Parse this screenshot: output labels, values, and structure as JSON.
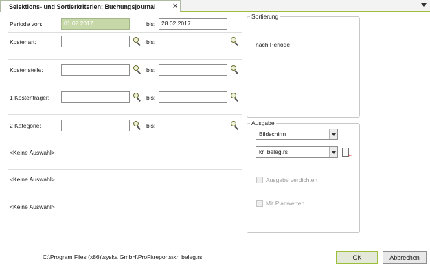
{
  "tab": {
    "title": "Selektions- und Sortierkriterien: Buchungsjournal",
    "close": "✕"
  },
  "rows": [
    {
      "label": "Periode von:",
      "from": "01.02.2017",
      "bis": "bis:",
      "to": "28.02.2017"
    },
    {
      "label": "Kostenart:",
      "from": "",
      "bis": "bis:",
      "to": ""
    },
    {
      "label": "Kostenstelle:",
      "from": "",
      "bis": "bis:",
      "to": ""
    },
    {
      "label": "1 Kostenträger:",
      "from": "",
      "bis": "bis:",
      "to": ""
    },
    {
      "label": "2 Kategorie:",
      "from": "",
      "bis": "bis:",
      "to": ""
    }
  ],
  "no_selection": [
    "<Keine Auswahl>",
    "<Keine Auswahl>",
    "<Keine Auswahl>"
  ],
  "sortierung": {
    "title": "Sortierung",
    "value": "nach Periode"
  },
  "ausgabe": {
    "title": "Ausgabe",
    "target": "Bildschirm",
    "report": "kr_beleg.rs",
    "compress_label": "Ausgabe verdichten",
    "plan_label": "Mit Planwerten"
  },
  "footer": {
    "path": "C:\\Program Files (x86)\\syska GmbH\\ProFi\\reports\\kr_beleg.rs",
    "ok": "OK",
    "cancel": "Abbrechen"
  },
  "colors": {
    "accent": "#9bbf3a",
    "selection": "#c6d8a8"
  }
}
